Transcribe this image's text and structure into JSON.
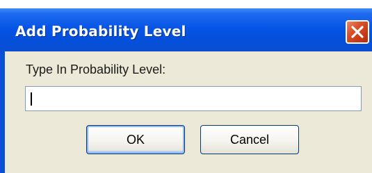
{
  "dialog": {
    "title": "Add Probability Level",
    "prompt": "Type In Probability Level:",
    "input_value": "",
    "ok_label": "OK",
    "cancel_label": "Cancel"
  },
  "icons": {
    "close": "close-icon"
  },
  "colors": {
    "titlebar": "#0755e6",
    "client_background": "#ece9d8",
    "close_button": "#c63b16",
    "input_border": "#7f9db9"
  }
}
